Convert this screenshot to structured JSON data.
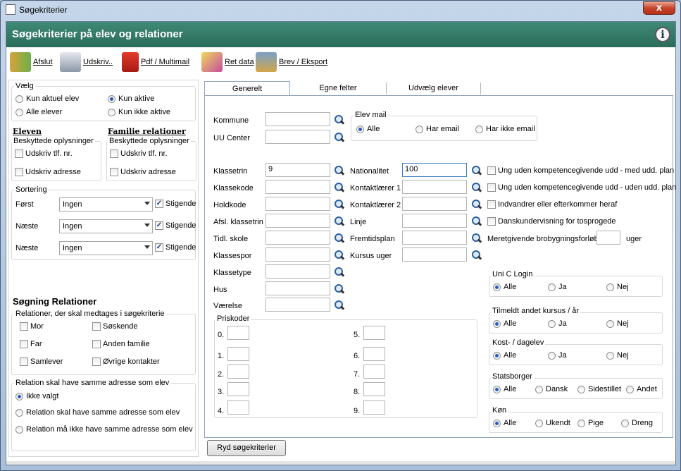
{
  "window": {
    "title": "Søgekriterier",
    "close_label": "x"
  },
  "header": {
    "title": "Søgekriterier på elev og relationer"
  },
  "toolbar": {
    "afslut": "Afslut",
    "udskriv": "Udskriv..",
    "pdf": "Pdf / Multimail",
    "ret_data": "Ret data",
    "brev": "Brev / Eksport"
  },
  "vaelg": {
    "legend": "Vælg",
    "kun_aktuel": "Kun aktuel elev",
    "alle_elever": "Alle elever",
    "kun_aktive": "Kun aktive",
    "kun_ikke_aktive": "Kun ikke aktive"
  },
  "eleven": {
    "title": "Eleven",
    "legend": "Beskyttede oplysninger",
    "tlf": "Udskriv tlf. nr.",
    "adresse": "Udskriv adresse"
  },
  "familie": {
    "title": "Familie relationer",
    "legend": "Beskyttede oplysninger",
    "tlf": "Udskriv tlf. nr.",
    "adresse": "Udskriv adresse"
  },
  "sortering": {
    "legend": "Sortering",
    "rows": [
      {
        "label": "Først",
        "value": "Ingen",
        "stigende": "Stigende"
      },
      {
        "label": "Næste",
        "value": "Ingen",
        "stigende": "Stigende"
      },
      {
        "label": "Næste",
        "value": "Ingen",
        "stigende": "Stigende"
      }
    ]
  },
  "relationer": {
    "title": "Søgning Relationer",
    "legend": "Relationer, der skal medtages i søgekriterie",
    "mor": "Mor",
    "far": "Far",
    "samlever": "Samlever",
    "soskende": "Søskende",
    "anden_familie": "Anden familie",
    "ovrige": "Øvrige kontakter"
  },
  "adresse": {
    "legend": "Relation skal have samme adresse som elev",
    "ikke_valgt": "Ikke valgt",
    "skal": "Relation skal have samme adresse som elev",
    "ma_ikke": "Relation må ikke have samme adresse som elev"
  },
  "tabs": {
    "generelt": "Generelt",
    "egne": "Egne felter",
    "udvaelg": "Udvælg elever"
  },
  "form": {
    "kommune": "Kommune",
    "uu_center": "UU Center",
    "klassetrin": "Klassetrin",
    "klassetrin_value": "9",
    "klassekode": "Klassekode",
    "holdkode": "Holdkode",
    "afsl_klassetrin": "Afsl. klassetrin",
    "tidl_skole": "Tidl. skole",
    "klassespor": "Klassespor",
    "klassetype": "Klassetype",
    "hus": "Hus",
    "vaerelse": "Værelse",
    "nationalitet": "Nationalitet",
    "nationalitet_value": "100",
    "kontaktlaerer1": "Kontaktlærer 1",
    "kontaktlaerer2": "Kontaktlærer 2",
    "linje": "Linje",
    "fremtidsplan": "Fremtidsplan",
    "kursus_uger": "Kursus uger"
  },
  "elevmail": {
    "legend": "Elev mail",
    "alle": "Alle",
    "har": "Har email",
    "har_ikke": "Har ikke email"
  },
  "checks": {
    "ung_med": "Ung uden kompetencegivende udd - med udd. plan",
    "ung_uden": "Ung uden kompetencegivende udd - uden udd. plan",
    "indvandrer": "Indvandrer eller efterkommer heraf",
    "dansk": "Danskundervisning for tosprogede",
    "meret": "Meretgivende brobygningsforløb",
    "uger": "uger"
  },
  "priskoder": {
    "legend": "Priskoder",
    "labels": [
      "0.",
      "1.",
      "2.",
      "3.",
      "4.",
      "5.",
      "6.",
      "7.",
      "8.",
      "9."
    ]
  },
  "unic": {
    "legend": "Uni C Login",
    "alle": "Alle",
    "ja": "Ja",
    "nej": "Nej"
  },
  "tilmeldt": {
    "legend": "Tilmeldt andet kursus / år",
    "alle": "Alle",
    "ja": "Ja",
    "nej": "Nej"
  },
  "kost": {
    "legend": "Kost- / dagelev",
    "alle": "Alle",
    "ja": "Ja",
    "nej": "Nej"
  },
  "statsborger": {
    "legend": "Statsborger",
    "alle": "Alle",
    "dansk": "Dansk",
    "sidestillet": "Sidestillet",
    "andet": "Andet"
  },
  "kon": {
    "legend": "Køn",
    "alle": "Alle",
    "ukendt": "Ukendt",
    "pige": "Pige",
    "dreng": "Dreng"
  },
  "ryd": "Ryd søgekriterier"
}
